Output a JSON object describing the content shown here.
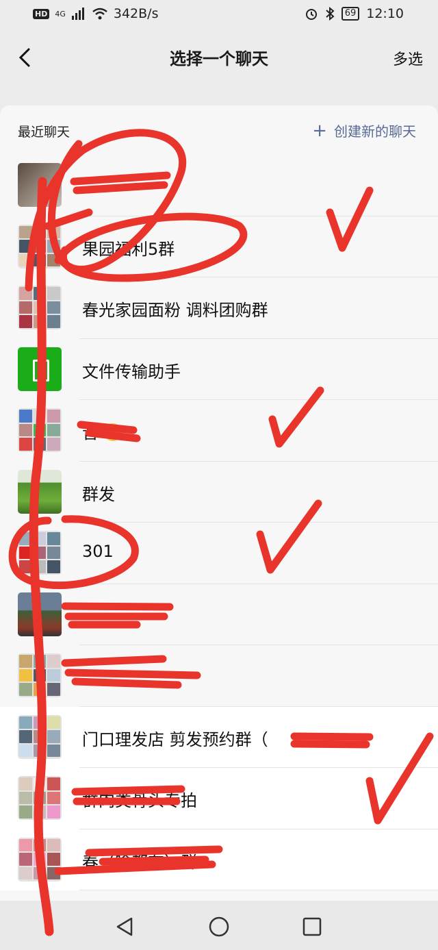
{
  "status_bar": {
    "hd": "HD",
    "net": "4G",
    "speed": "342B/s",
    "battery": "69",
    "time": "12:10"
  },
  "nav": {
    "title": "选择一个聊天",
    "multi_select": "多选"
  },
  "section": {
    "recent": "最近聊天",
    "create": "创建新的聊天"
  },
  "chats": [
    {
      "label": ""
    },
    {
      "label": "果园福利5群"
    },
    {
      "label": "春光家园面粉 调料团购群"
    },
    {
      "label": "文件传输助手"
    },
    {
      "label": "音"
    },
    {
      "label": "群发"
    },
    {
      "label": "301"
    },
    {
      "label": ""
    },
    {
      "label": ""
    },
    {
      "label": "门口理发店 剪发预约群（"
    },
    {
      "label": "群肉类骨头专拍"
    },
    {
      "label": "春（啥都有）群"
    }
  ],
  "colors": {
    "link": "#576b95",
    "scribble": "#e8342b",
    "file_helper": "#1aad19"
  },
  "icons": [
    "back-arrow-icon",
    "plus-icon",
    "nav-back-icon",
    "nav-home-icon",
    "nav-recents-icon"
  ]
}
